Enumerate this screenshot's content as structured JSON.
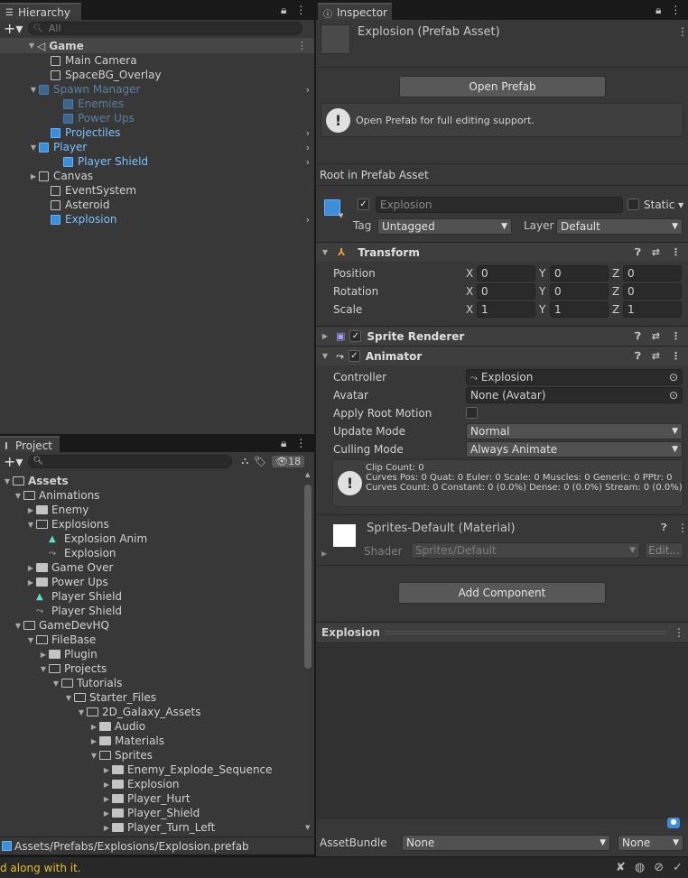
{
  "hierarchy": {
    "tab": "Hierarchy",
    "search_placeholder": "All",
    "scene": "Game",
    "items": [
      {
        "label": "Main Camera",
        "style": "normal"
      },
      {
        "label": "SpaceBG_Overlay",
        "style": "normal"
      },
      {
        "label": "Spawn Manager",
        "style": "faded"
      },
      {
        "label": "Enemies",
        "style": "faded"
      },
      {
        "label": "Power Ups",
        "style": "faded"
      },
      {
        "label": "Projectiles",
        "style": "blue"
      },
      {
        "label": "Player",
        "style": "blue"
      },
      {
        "label": "Player Shield",
        "style": "blue"
      },
      {
        "label": "Canvas",
        "style": "normal"
      },
      {
        "label": "EventSystem",
        "style": "normal"
      },
      {
        "label": "Asteroid",
        "style": "normal"
      },
      {
        "label": "Explosion",
        "style": "blue"
      }
    ]
  },
  "project": {
    "tab": "Project",
    "hidden_count": "18",
    "items": [
      "Assets",
      "Animations",
      "Enemy",
      "Explosions",
      "Explosion Anim",
      "Explosion",
      "Game Over",
      "Power Ups",
      "Player Shield",
      "Player Shield",
      "GameDevHQ",
      "FileBase",
      "Plugin",
      "Projects",
      "Tutorials",
      "Starter_Files",
      "2D_Galaxy_Assets",
      "Audio",
      "Materials",
      "Sprites",
      "Enemy_Explode_Sequence",
      "Explosion",
      "Player_Hurt",
      "Player_Shield",
      "Player_Turn_Left"
    ],
    "path": "Assets/Prefabs/Explosions/Explosion.prefab"
  },
  "inspector": {
    "tab": "Inspector",
    "title": "Explosion (Prefab Asset)",
    "open_prefab": "Open Prefab",
    "info": "Open Prefab for full editing support.",
    "root_label": "Root in Prefab Asset",
    "name": "Explosion",
    "static": "Static",
    "tag_label": "Tag",
    "tag": "Untagged",
    "layer_label": "Layer",
    "layer": "Default",
    "transform": {
      "title": "Transform",
      "position": "Position",
      "rotation": "Rotation",
      "scale": "Scale",
      "x": "X",
      "y": "Y",
      "z": "Z",
      "pos": [
        "0",
        "0",
        "0"
      ],
      "rot": [
        "0",
        "0",
        "0"
      ],
      "scl": [
        "1",
        "1",
        "1"
      ]
    },
    "sprite_renderer": "Sprite Renderer",
    "animator": {
      "title": "Animator",
      "controller_label": "Controller",
      "controller": "Explosion",
      "avatar_label": "Avatar",
      "avatar": "None (Avatar)",
      "root_motion_label": "Apply Root Motion",
      "update_label": "Update Mode",
      "update": "Normal",
      "culling_label": "Culling Mode",
      "culling": "Always Animate",
      "info1": "Clip Count: 0",
      "info2": "Curves Pos: 0 Quat: 0 Euler: 0 Scale: 0 Muscles: 0 Generic: 0 PPtr: 0",
      "info3": "Curves Count: 0 Constant: 0 (0.0%) Dense: 0 (0.0%) Stream: 0 (0.0%)"
    },
    "material": {
      "name": "Sprites-Default (Material)",
      "shader_label": "Shader",
      "shader": "Sprites/Default",
      "edit": "Edit..."
    },
    "add_component": "Add Component",
    "preview_title": "Explosion",
    "assetbundle_label": "AssetBundle",
    "assetbundle": "None",
    "variant": "None"
  },
  "status": {
    "message": "d along with it."
  }
}
